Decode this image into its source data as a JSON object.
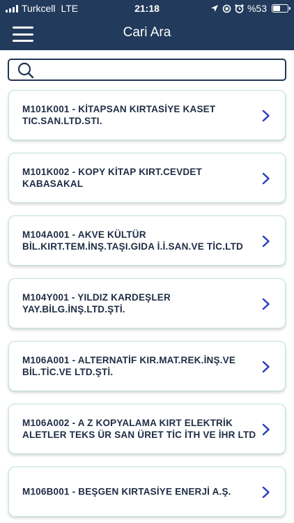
{
  "status_bar": {
    "carrier": "Turkcell",
    "network": "LTE",
    "time": "21:18",
    "battery_text": "%53",
    "battery_level": 0.53,
    "icons": [
      "location-arrow-icon",
      "orientation-lock-icon",
      "alarm-icon"
    ]
  },
  "nav": {
    "title": "Cari Ara",
    "menu_icon": "hamburger-menu-icon"
  },
  "search": {
    "value": "",
    "placeholder": "",
    "icon": "search-icon"
  },
  "items": [
    {
      "line1": "M101K001 - KİTAPSAN KIRTASİYE KASET",
      "line2": "TIC.SAN.LTD.STI."
    },
    {
      "line1": "M101K002 - KOPY KİTAP KIRT.CEVDET",
      "line2": "KABASAKAL"
    },
    {
      "line1": "M104A001 - AKVE KÜLTÜR",
      "line2": "BİL.KIRT.TEM.İNŞ.TAŞI.GIDA İ.İ.SAN.VE TİC.LTD"
    },
    {
      "line1": "M104Y001 - YILDIZ KARDEŞLER",
      "line2": "YAY.BİLG.İNŞ.LTD.ŞTİ."
    },
    {
      "line1": "M106A001 - ALTERNATİF KIR.MAT.REK.İNŞ.VE",
      "line2": "BİL.TİC.VE LTD.ŞTİ."
    },
    {
      "line1": "M106A002 - A Z KOPYALAMA KIRT ELEKTRİK",
      "line2": "ALETLER TEKS ÜR SAN ÜRET TİC İTH VE İHR LTD"
    },
    {
      "line1": "M106B001 - BEŞGEN KIRTASİYE ENERJİ A.Ş.",
      "line2": ""
    }
  ],
  "colors": {
    "header": "#223a5b",
    "card_border": "#bfe3e3",
    "text": "#1e2c44",
    "chevron": "#2a3bbf"
  }
}
